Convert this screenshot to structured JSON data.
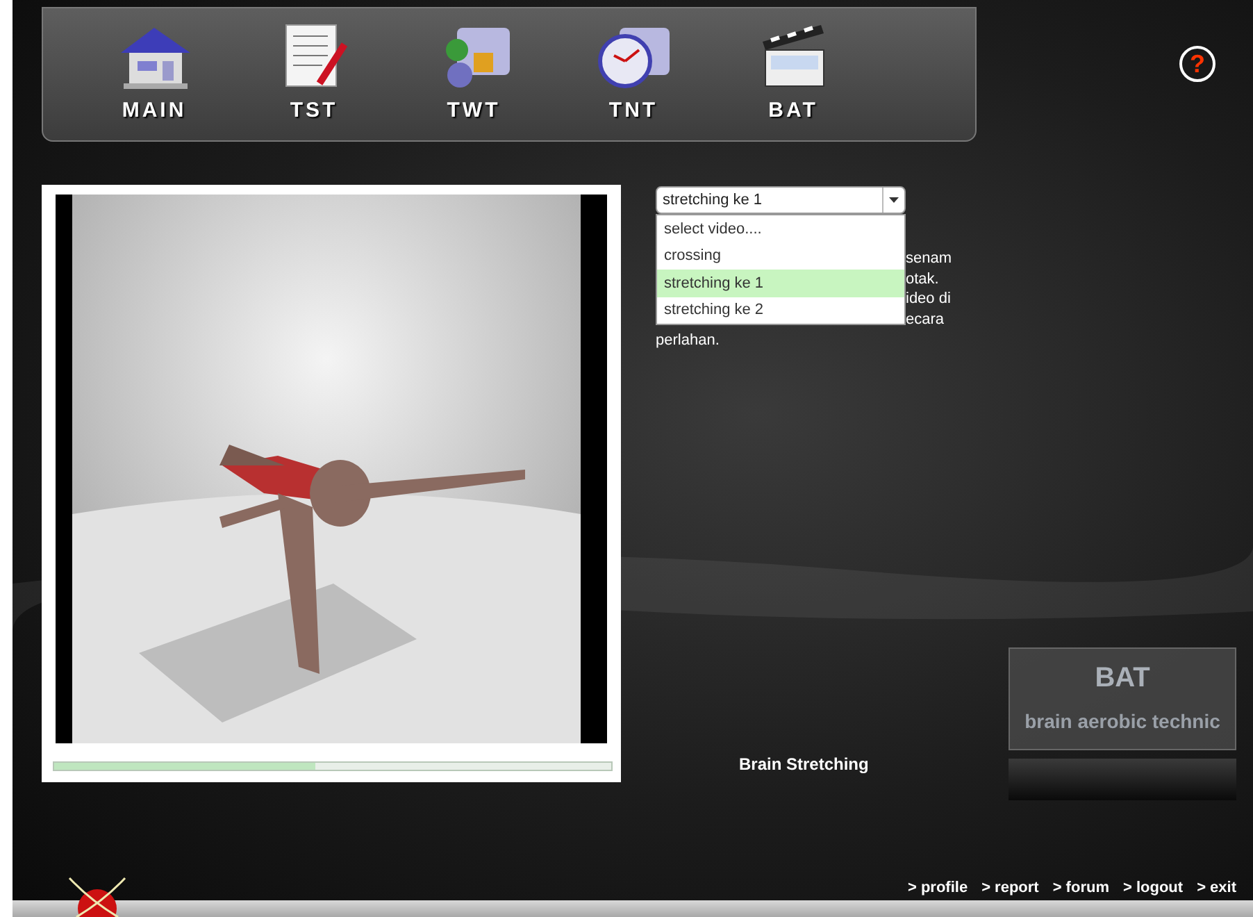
{
  "nav": [
    {
      "label": "MAIN",
      "kind": "house"
    },
    {
      "label": "TST",
      "kind": "document"
    },
    {
      "label": "TWT",
      "kind": "letters"
    },
    {
      "label": "TNT",
      "kind": "clock"
    },
    {
      "label": "BAT",
      "kind": "clapper"
    }
  ],
  "help": {
    "symbol": "?"
  },
  "video": {
    "progress": {
      "level": 0.47
    }
  },
  "video_select": {
    "value": "stretching ke 1",
    "expanded": true,
    "options": [
      {
        "label": "select video....",
        "selected": false
      },
      {
        "label": "crossing",
        "selected": false
      },
      {
        "label": "stretching ke 1",
        "selected": true
      },
      {
        "label": "stretching ke 2",
        "selected": false
      }
    ]
  },
  "description": {
    "hidden_lines": [
      "senam",
      "otak.",
      "ideo di",
      "ecara"
    ],
    "last_line": "perlahan."
  },
  "caption": "Brain Stretching",
  "info_card": {
    "title": "BAT",
    "subtitle": "brain aerobic technic"
  },
  "footer_links": [
    "> profile",
    "> report",
    "> forum",
    "> logout",
    "> exit"
  ]
}
